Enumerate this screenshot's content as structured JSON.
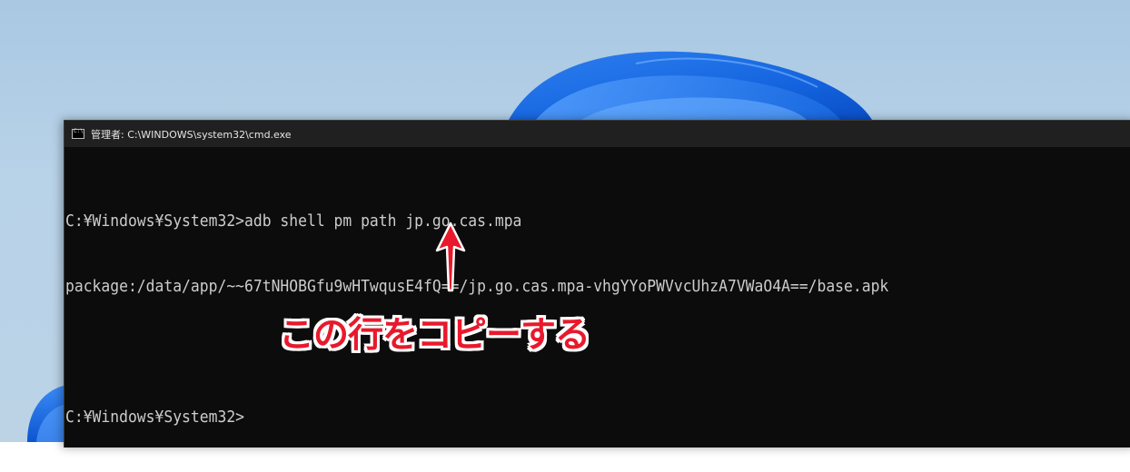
{
  "window": {
    "title": "管理者: C:\\WINDOWS\\system32\\cmd.exe",
    "icon": "cmd-icon"
  },
  "console": {
    "lines": [
      "C:¥Windows¥System32>adb shell pm path jp.go.cas.mpa",
      "package:/data/app/~~67tNHOBGfu9wHTwqusE4fQ==/jp.go.cas.mpa-vhgYYoPWVvcUhzA7VWaO4A==/base.apk",
      "",
      "C:¥Windows¥System32>"
    ]
  },
  "annotation": {
    "label": "この行をコピーする",
    "color": "#e8192c"
  },
  "colors": {
    "console_bg": "#0c0c0c",
    "console_text": "#cccccc",
    "titlebar_bg": "#202020"
  }
}
